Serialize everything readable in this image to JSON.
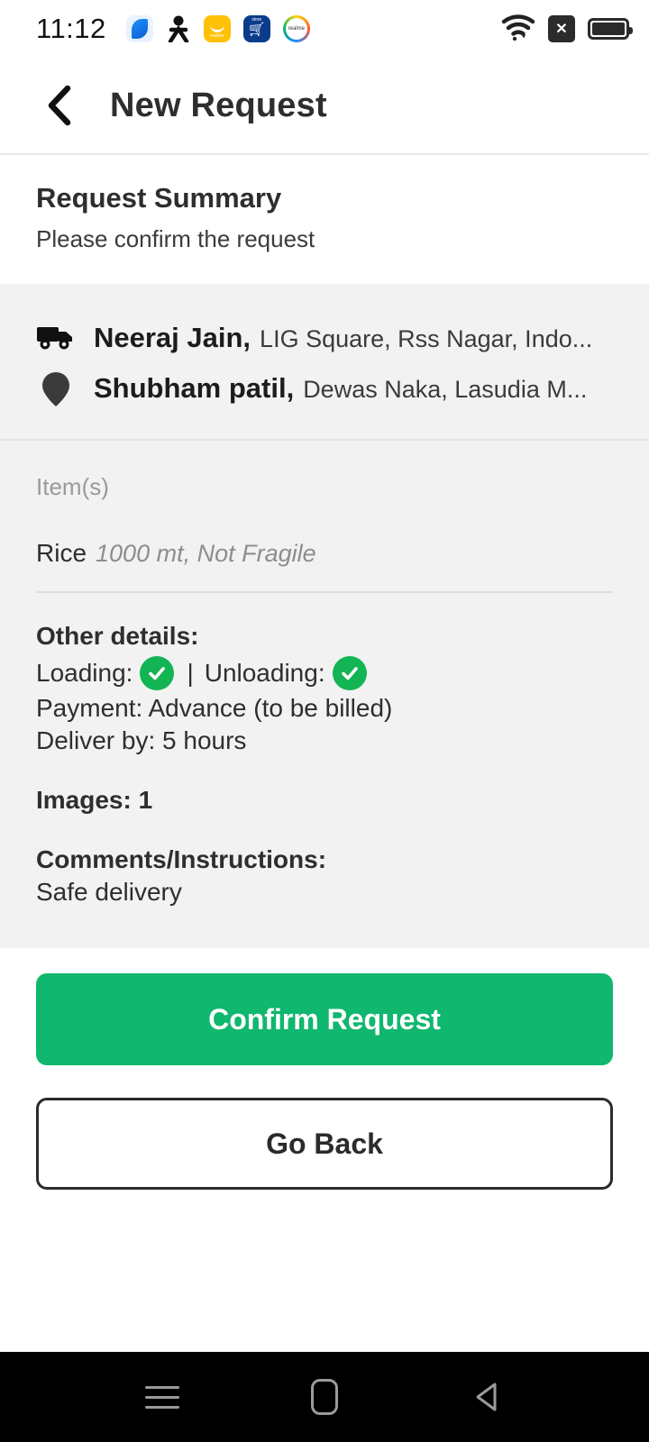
{
  "status_bar": {
    "time": "11:12",
    "left_icons": [
      "messages-app-icon",
      "person-icon",
      "realme-store-icon",
      "shopping-app-icon",
      "realme-community-icon"
    ],
    "right_icons": [
      "wifi-icon",
      "sim-no-service-icon",
      "battery-full-icon"
    ],
    "sim_glyph": "✕"
  },
  "app_bar": {
    "back_label": "back-arrow",
    "title": "New Request"
  },
  "summary": {
    "title": "Request Summary",
    "subtitle": "Please confirm the request"
  },
  "addresses": [
    {
      "icon": "truck-icon",
      "name": "Neeraj Jain,",
      "detail": "LIG Square, Rss Nagar, Indo..."
    },
    {
      "icon": "map-pin-icon",
      "name": "Shubham patil,",
      "detail": "Dewas Naka, Lasudia M..."
    }
  ],
  "items": {
    "label": "Item(s)",
    "list": [
      {
        "name": "Rice",
        "meta": "1000 mt, Not Fragile"
      }
    ]
  },
  "other_details": {
    "title": "Other details:",
    "loading_label": "Loading:",
    "loading_checked": true,
    "separator": "|",
    "unloading_label": "Unloading:",
    "unloading_checked": true,
    "payment": "Payment: Advance (to be billed)",
    "deliver_by": "Deliver by: 5 hours",
    "images": "Images: 1",
    "comments_title": "Comments/Instructions:",
    "comments_value": "Safe delivery"
  },
  "actions": {
    "confirm_label": "Confirm Request",
    "go_back_label": "Go Back"
  },
  "nav_bar": {
    "recents": "recents-icon",
    "home": "home-icon",
    "back": "back-icon"
  },
  "colors": {
    "accent_green": "#10b76e",
    "check_green": "#12b453",
    "card_bg": "#f2f2f2",
    "text_dark": "#2e2e2e",
    "text_muted": "#8d8d8d"
  }
}
